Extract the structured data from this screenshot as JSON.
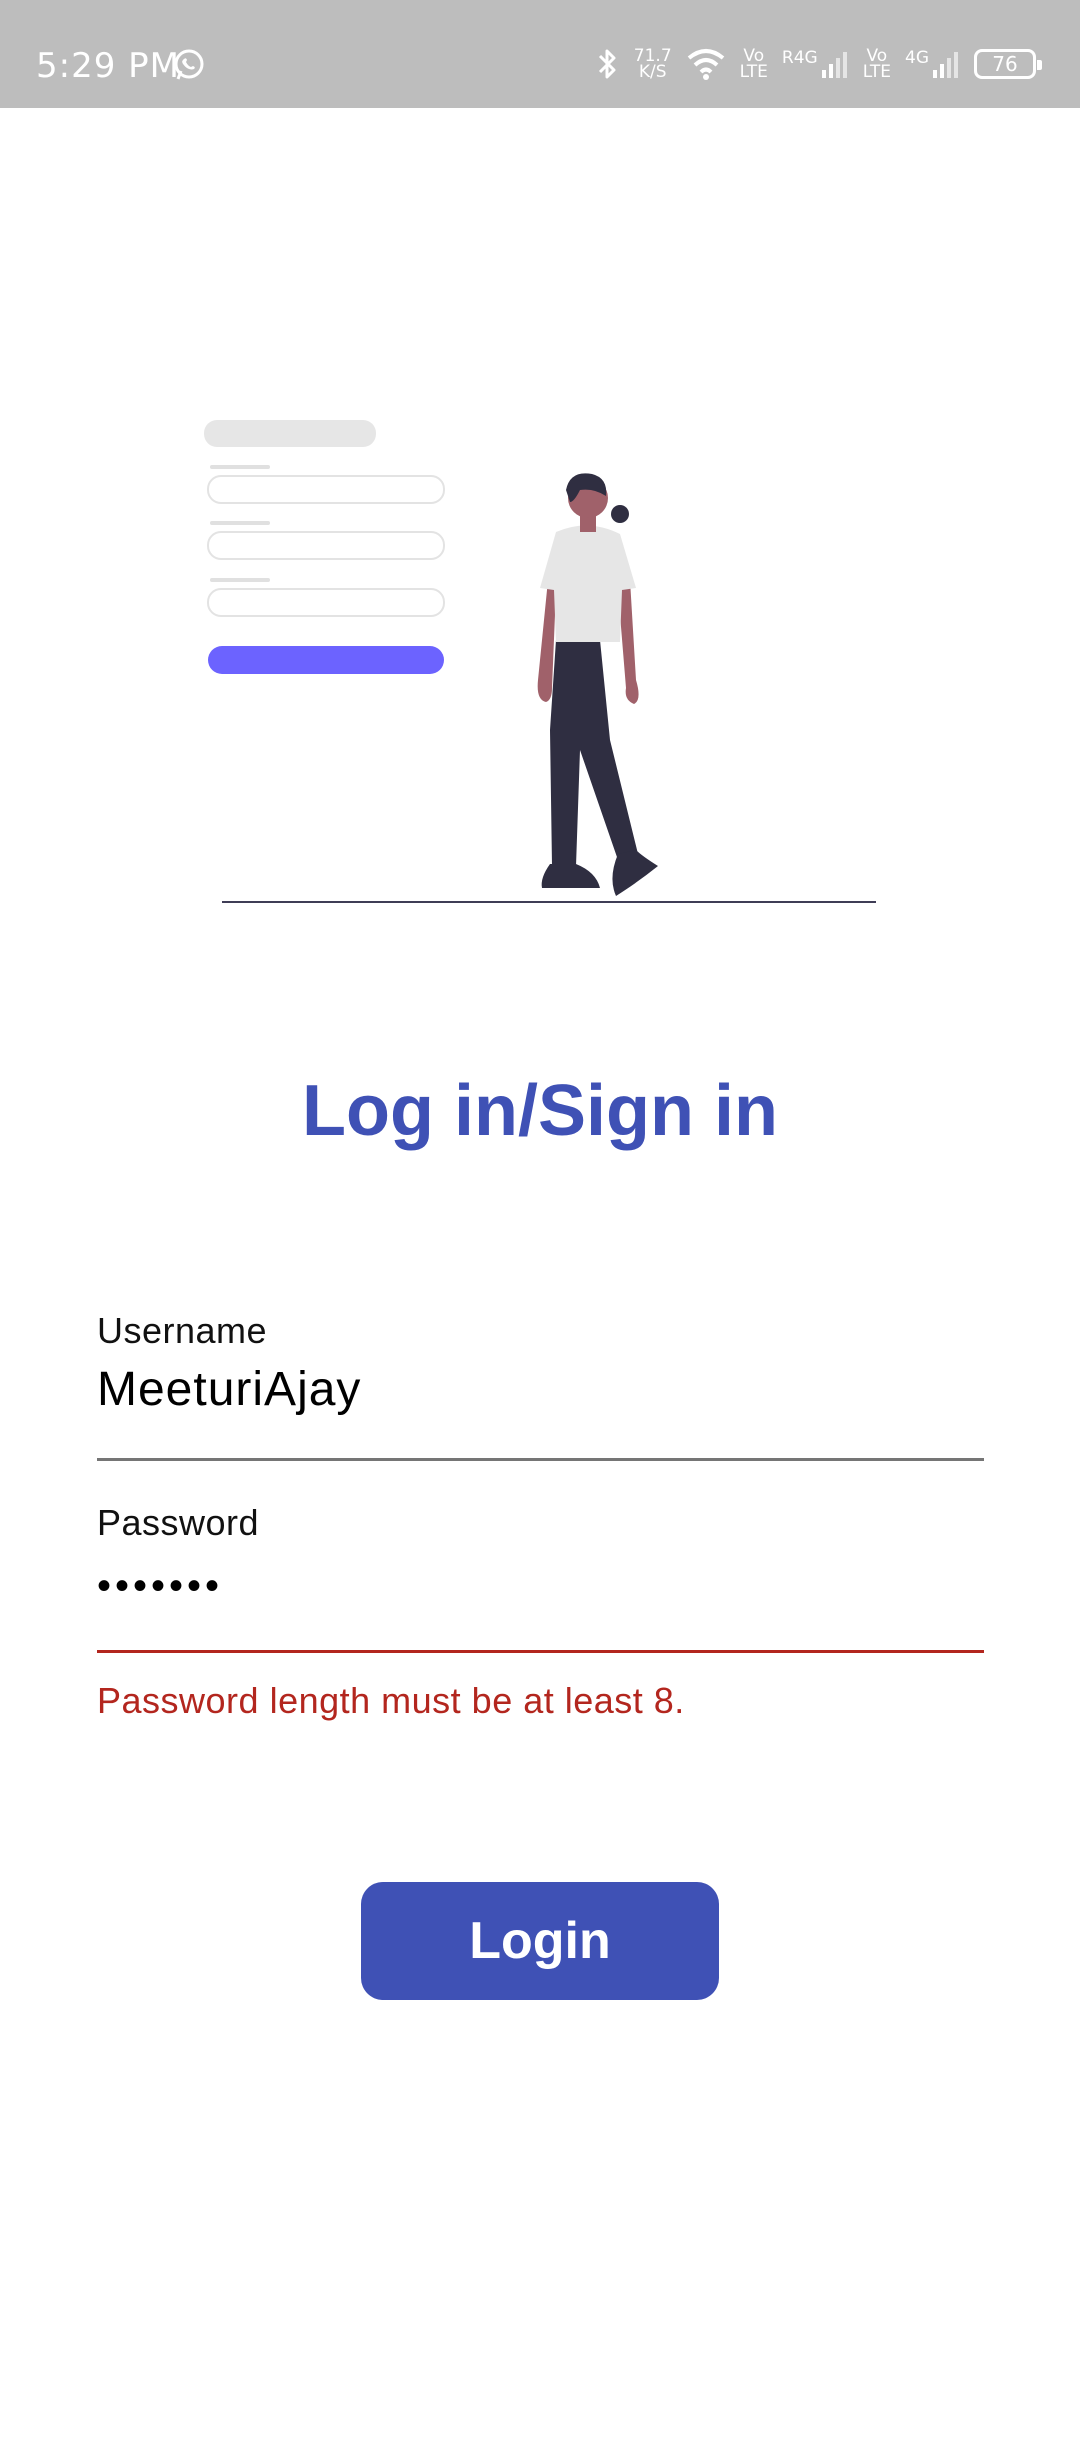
{
  "status_bar": {
    "time": "5:29 PM",
    "net_speed_value": "71.7",
    "net_speed_unit": "K/S",
    "volte1_top": "Vo",
    "volte1_bottom": "LTE",
    "r4g": "R4G",
    "volte2_top": "Vo",
    "volte2_bottom": "LTE",
    "g4": "4G",
    "battery": "76",
    "icons": [
      "whatsapp-icon",
      "bluetooth-icon",
      "wifi-icon",
      "signal-icon",
      "signal-icon",
      "battery-icon"
    ]
  },
  "title": "Log in/Sign in",
  "username": {
    "label": "Username",
    "value": "MeeturiAjay"
  },
  "password": {
    "label": "Password",
    "value": "•••••••",
    "error": "Password length must be at least 8."
  },
  "login_button": "Login",
  "colors": {
    "primary": "#3f51b5",
    "error": "#b3261e",
    "status_bar": "#bdbdbd",
    "illustration_accent": "#6c63ff"
  }
}
